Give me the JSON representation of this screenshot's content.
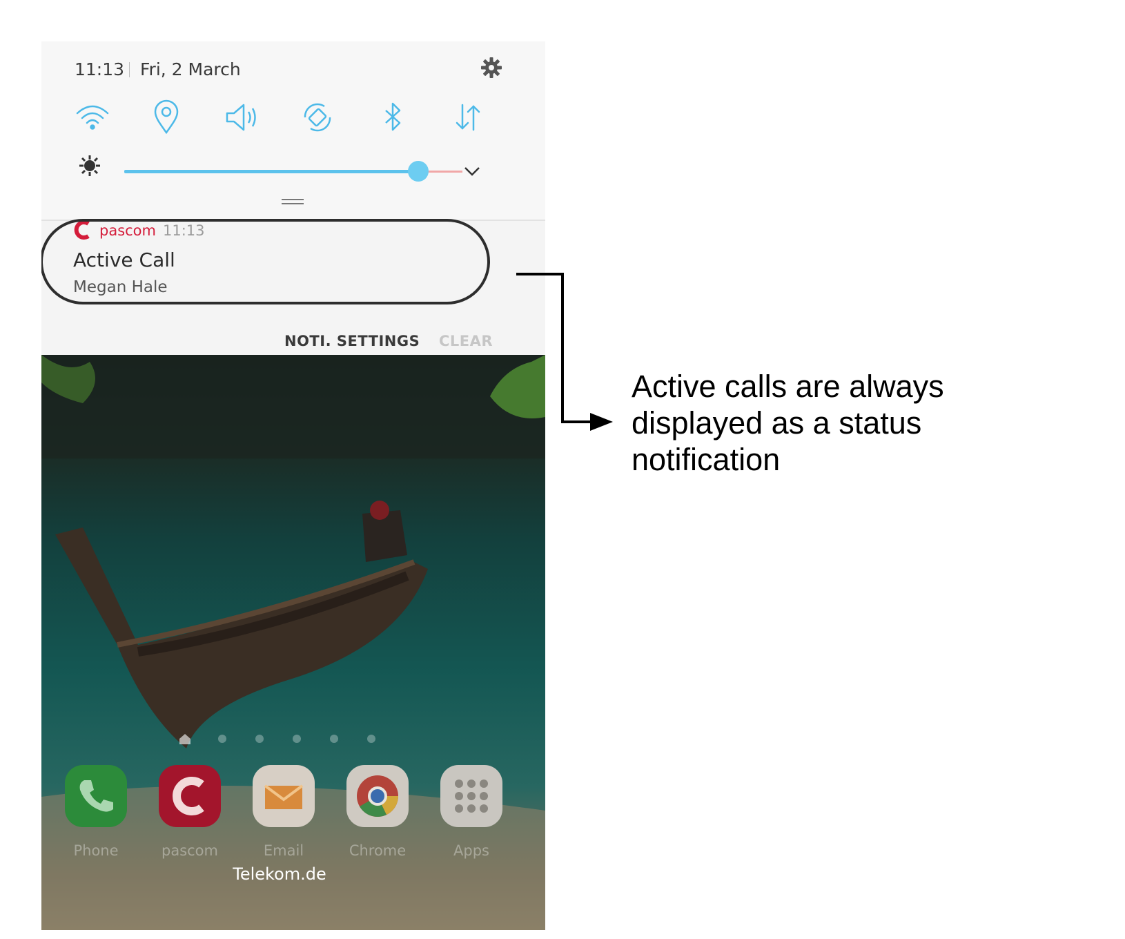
{
  "status_bar": {
    "time": "11:13",
    "date": "Fri, 2 March"
  },
  "quick_settings": {
    "tiles": [
      {
        "icon": "wifi-icon"
      },
      {
        "icon": "location-icon"
      },
      {
        "icon": "sound-icon"
      },
      {
        "icon": "auto-rotate-icon"
      },
      {
        "icon": "bluetooth-icon"
      },
      {
        "icon": "mobile-data-icon"
      }
    ],
    "brightness_level": 0.87,
    "accent_color": "#5cc2ec"
  },
  "notification": {
    "app_name": "pascom",
    "time": "11:13",
    "title": "Active Call",
    "subtitle": "Megan Hale",
    "app_color": "#d41c3a"
  },
  "notification_actions": {
    "settings_label": "NOTI. SETTINGS",
    "clear_label": "CLEAR"
  },
  "home_screen": {
    "dock": [
      {
        "label": "Phone",
        "icon": "phone-icon"
      },
      {
        "label": "pascom",
        "icon": "pascom-icon"
      },
      {
        "label": "Email",
        "icon": "email-icon"
      },
      {
        "label": "Chrome",
        "icon": "chrome-icon"
      },
      {
        "label": "Apps",
        "icon": "apps-grid-icon"
      }
    ],
    "carrier": "Telekom.de"
  },
  "callout": {
    "text": "Active calls are always displayed as a status notification"
  }
}
